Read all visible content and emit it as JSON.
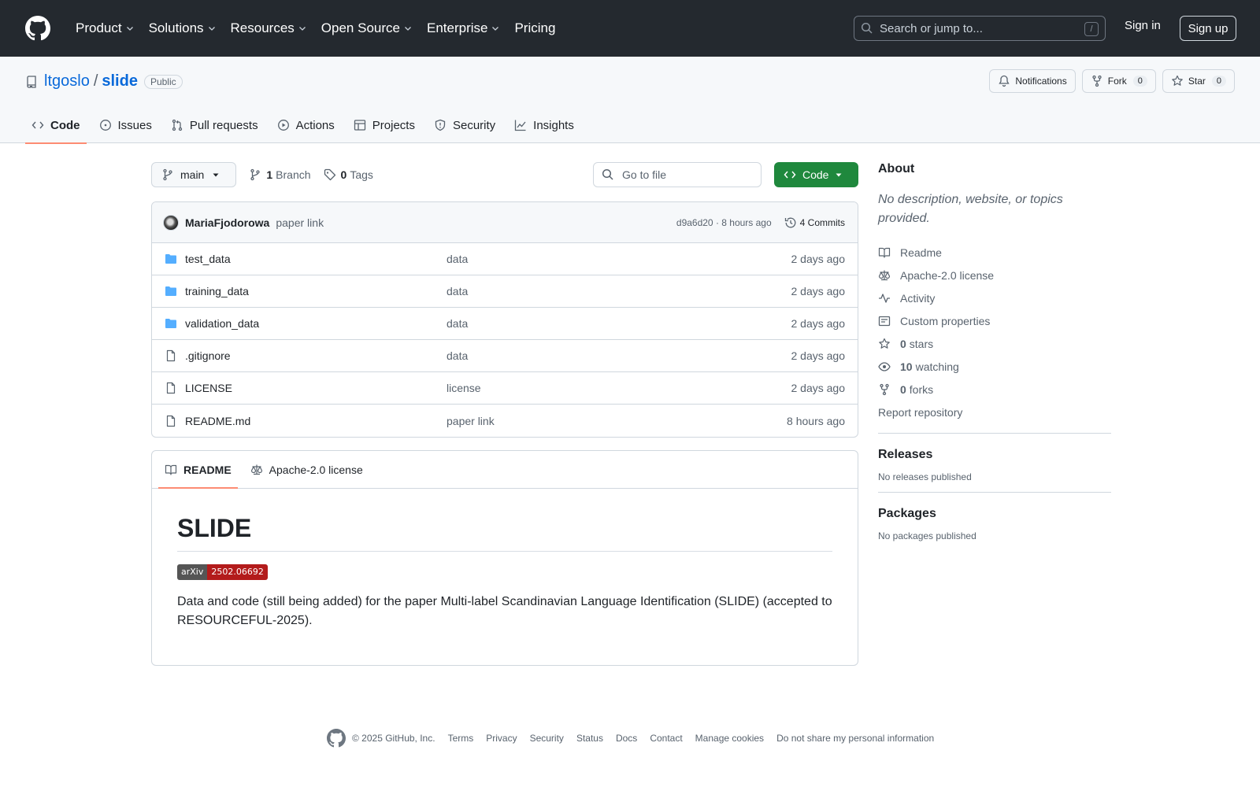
{
  "header": {
    "nav": [
      "Product",
      "Solutions",
      "Resources",
      "Open Source",
      "Enterprise",
      "Pricing"
    ],
    "nav_has_chevron": [
      true,
      true,
      true,
      true,
      true,
      false
    ],
    "search_placeholder": "Search or jump to...",
    "search_shortcut": "/",
    "sign_in": "Sign in",
    "sign_up": "Sign up"
  },
  "repo": {
    "owner": "ltgoslo",
    "separator": "/",
    "name": "slide",
    "visibility": "Public",
    "actions": {
      "notifications": "Notifications",
      "fork": "Fork",
      "fork_count": "0",
      "star": "Star",
      "star_count": "0"
    },
    "tabs": [
      "Code",
      "Issues",
      "Pull requests",
      "Actions",
      "Projects",
      "Security",
      "Insights"
    ],
    "active_tab": "Code"
  },
  "toolbar": {
    "branch": "main",
    "branch_count": "1",
    "branch_label": "Branch",
    "tag_count": "0",
    "tag_label": "Tags",
    "goto_placeholder": "Go to file",
    "code_button": "Code"
  },
  "commit": {
    "author": "MariaFjodorowa",
    "message": "paper link",
    "hash_time": "d9a6d20 · 8 hours ago",
    "commits": "4 Commits"
  },
  "files": [
    {
      "name": "test_data",
      "type": "folder",
      "commit": "data",
      "date": "2 days ago"
    },
    {
      "name": "training_data",
      "type": "folder",
      "commit": "data",
      "date": "2 days ago"
    },
    {
      "name": "validation_data",
      "type": "folder",
      "commit": "data",
      "date": "2 days ago"
    },
    {
      "name": ".gitignore",
      "type": "file",
      "commit": "data",
      "date": "2 days ago"
    },
    {
      "name": "LICENSE",
      "type": "file",
      "commit": "license",
      "date": "2 days ago"
    },
    {
      "name": "README.md",
      "type": "file",
      "commit": "paper link",
      "date": "8 hours ago"
    }
  ],
  "readme": {
    "tabs": [
      "README",
      "Apache-2.0 license"
    ],
    "title": "SLIDE",
    "badge_left": "arXiv",
    "badge_right": "2502.06692",
    "paragraph": "Data and code (still being added) for the paper Multi-label Scandinavian Language Identification (SLIDE) (accepted to RESOURCEFUL-2025)."
  },
  "about": {
    "title": "About",
    "description": "No description, website, or topics provided.",
    "readme": "Readme",
    "license": "Apache-2.0 license",
    "activity": "Activity",
    "custom_properties": "Custom properties",
    "stars_count": "0",
    "stars_label": "stars",
    "watching_count": "10",
    "watching_label": "watching",
    "forks_count": "0",
    "forks_label": "forks",
    "report": "Report repository"
  },
  "releases": {
    "title": "Releases",
    "empty": "No releases published"
  },
  "packages": {
    "title": "Packages",
    "empty": "No packages published"
  },
  "footer": {
    "copyright": "© 2025 GitHub, Inc.",
    "links": [
      "Terms",
      "Privacy",
      "Security",
      "Status",
      "Docs",
      "Contact",
      "Manage cookies",
      "Do not share my personal information"
    ]
  },
  "colors": {
    "header_bg": "#24292f",
    "link": "#0969da",
    "green": "#1f883d",
    "folder": "#54aeff",
    "tab_underline": "#fd8c73"
  }
}
